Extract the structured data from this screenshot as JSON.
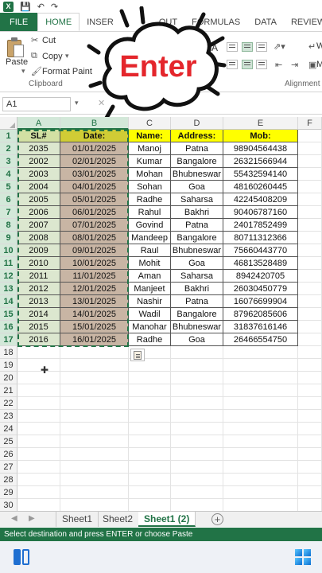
{
  "quick_access": {
    "logo": "X",
    "icons": [
      "save-icon",
      "undo-icon",
      "redo-icon"
    ]
  },
  "ribbon": {
    "tabs": [
      "FILE",
      "HOME",
      "INSERT",
      "PAGE LAYOUT",
      "FORMULAS",
      "DATA",
      "REVIEW"
    ],
    "tab_insert_visible": "INSER",
    "tab_layout_visible": "OUT",
    "paste_label": "Paste",
    "cut_label": "Cut",
    "copy_label": "Copy",
    "format_painter_label": "Format Paint",
    "clipboard_group": "Clipboard",
    "alignment_group": "Alignment",
    "font_letter": "A",
    "partial_right_top": "W",
    "partial_right_bottom": "M"
  },
  "callout": {
    "text": "Enter"
  },
  "formula_bar": {
    "name_box": "A1"
  },
  "grid": {
    "columns": [
      "A",
      "B",
      "C",
      "D",
      "E",
      "F"
    ],
    "selected_columns": [
      "A",
      "B"
    ],
    "header_row": [
      "SL#",
      "Date:",
      "Name:",
      "Address:",
      "Mob:"
    ],
    "rows": [
      [
        "2035",
        "01/01/2025",
        "Manoj",
        "Patna",
        "98904564438"
      ],
      [
        "2002",
        "02/01/2025",
        "Kumar",
        "Bangalore",
        "26321566944"
      ],
      [
        "2003",
        "03/01/2025",
        "Mohan",
        "Bhubneswar",
        "55432594140"
      ],
      [
        "2004",
        "04/01/2025",
        "Sohan",
        "Goa",
        "48160260445"
      ],
      [
        "2005",
        "05/01/2025",
        "Radhe",
        "Saharsa",
        "42245408209"
      ],
      [
        "2006",
        "06/01/2025",
        "Rahul",
        "Bakhri",
        "90406787160"
      ],
      [
        "2007",
        "07/01/2025",
        "Govind",
        "Patna",
        "24017852499"
      ],
      [
        "2008",
        "08/01/2025",
        "Mandeep",
        "Bangalore",
        "80711312366"
      ],
      [
        "2009",
        "09/01/2025",
        "Raul",
        "Bhubneswar",
        "75660443770"
      ],
      [
        "2010",
        "10/01/2025",
        "Mohit",
        "Goa",
        "46813528489"
      ],
      [
        "2011",
        "11/01/2025",
        "Aman",
        "Saharsa",
        "8942420705"
      ],
      [
        "2012",
        "12/01/2025",
        "Manjeet",
        "Bakhri",
        "26030450779"
      ],
      [
        "2013",
        "13/01/2025",
        "Nashir",
        "Patna",
        "16076699904"
      ],
      [
        "2014",
        "14/01/2025",
        "Wadil",
        "Bangalore",
        "87962085606"
      ],
      [
        "2015",
        "15/01/2025",
        "Manohar",
        "Bhubneswar",
        "31837616146"
      ],
      [
        "2016",
        "16/01/2025",
        "Radhe",
        "Goa",
        "26466554750"
      ]
    ],
    "row_numbers": [
      "1",
      "2",
      "3",
      "4",
      "5",
      "6",
      "7",
      "8",
      "9",
      "10",
      "11",
      "12",
      "13",
      "14",
      "15",
      "16",
      "17",
      "18",
      "19",
      "20",
      "21",
      "22",
      "23",
      "24",
      "25",
      "26",
      "27",
      "28",
      "29",
      "30"
    ]
  },
  "sheet_tabs": [
    "Sheet1",
    "Sheet2",
    "Sheet1 (2)"
  ],
  "active_sheet": "Sheet1 (2)",
  "status_bar": {
    "text": "Select destination and press ENTER or choose Paste"
  },
  "colors": {
    "excel_green": "#217346",
    "header_yellow": "#ffff00",
    "callout_red": "#e4262c"
  }
}
